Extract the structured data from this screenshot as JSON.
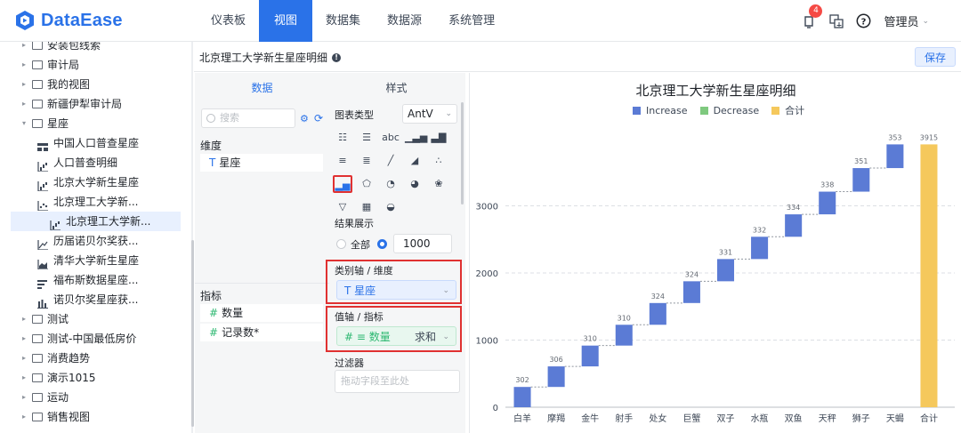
{
  "app": {
    "name": "DataEase"
  },
  "nav": [
    {
      "label": "仪表板",
      "active": false
    },
    {
      "label": "视图",
      "active": true
    },
    {
      "label": "数据集",
      "active": false
    },
    {
      "label": "数据源",
      "active": false
    },
    {
      "label": "系统管理",
      "active": false
    }
  ],
  "header": {
    "notification_count": "4",
    "user": "管理员"
  },
  "tree": [
    {
      "label": "安装包线索",
      "type": "folder",
      "level": 1,
      "expanded": false
    },
    {
      "label": "审计局",
      "type": "folder",
      "level": 1,
      "expanded": false
    },
    {
      "label": "我的视图",
      "type": "folder",
      "level": 1,
      "expanded": false
    },
    {
      "label": "新疆伊犁审计局",
      "type": "folder",
      "level": 1,
      "expanded": false
    },
    {
      "label": "星座",
      "type": "folder",
      "level": 1,
      "expanded": true
    },
    {
      "label": "中国人口普查星座",
      "type": "table",
      "level": 2
    },
    {
      "label": "人口普查明细",
      "type": "waterfall",
      "level": 2
    },
    {
      "label": "北京大学新生星座",
      "type": "waterfall",
      "level": 2
    },
    {
      "label": "北京理工大学新...",
      "type": "scatter",
      "level": 2
    },
    {
      "label": "北京理工大学新...",
      "type": "waterfall",
      "level": 2,
      "selected": true
    },
    {
      "label": "历届诺贝尔奖获...",
      "type": "line",
      "level": 2
    },
    {
      "label": "清华大学新生星座",
      "type": "area",
      "level": 2
    },
    {
      "label": "福布斯数据星座...",
      "type": "hbar",
      "level": 2
    },
    {
      "label": "诺贝尔奖星座获...",
      "type": "bar",
      "level": 2
    },
    {
      "label": "测试",
      "type": "folder",
      "level": 1,
      "expanded": false
    },
    {
      "label": "测试-中国最低房价",
      "type": "folder",
      "level": 1,
      "expanded": false
    },
    {
      "label": "消费趋势",
      "type": "folder",
      "level": 1,
      "expanded": false
    },
    {
      "label": "演示1015",
      "type": "folder",
      "level": 1,
      "expanded": false
    },
    {
      "label": "运动",
      "type": "folder",
      "level": 1,
      "expanded": false
    },
    {
      "label": "销售视图",
      "type": "folder",
      "level": 1,
      "expanded": false
    }
  ],
  "editor": {
    "title": "北京理工大学新生星座明细",
    "save_label": "保存"
  },
  "data_panel": {
    "tab": "数据",
    "search_placeholder": "搜索",
    "dimension_label": "维度",
    "dimensions": [
      {
        "label": "星座"
      }
    ],
    "measure_label": "指标",
    "measures": [
      {
        "label": "数量"
      },
      {
        "label": "记录数*"
      }
    ]
  },
  "style_panel": {
    "tab": "样式",
    "chart_type_label": "图表类型",
    "engine": "AntV",
    "result_label": "结果展示",
    "all_label": "全部",
    "limit_value": "1000",
    "category_axis_label": "类别轴 / 维度",
    "category_field": "星座",
    "value_axis_label": "值轴 / 指标",
    "value_field": "数量",
    "aggregation": "求和",
    "filter_label": "过滤器",
    "filter_placeholder": "拖动字段至此处"
  },
  "colors": {
    "increase": "#5b7bd5",
    "decrease": "#7fc97f",
    "total": "#f5c85c",
    "accent": "#2a72e8",
    "highlight": "#e03131"
  },
  "chart_data": {
    "type": "waterfall",
    "title": "北京理工大学新生星座明细",
    "legend": [
      "Increase",
      "Decrease",
      "合计"
    ],
    "legend_position": "top-center",
    "categories": [
      "白羊",
      "摩羯",
      "金牛",
      "射手",
      "处女",
      "巨蟹",
      "双子",
      "水瓶",
      "双鱼",
      "天秤",
      "狮子",
      "天蝎",
      "合计"
    ],
    "values": [
      302,
      306,
      310,
      310,
      324,
      324,
      331,
      332,
      334,
      338,
      351,
      353,
      3915
    ],
    "yticks": [
      0,
      1000,
      2000,
      3000
    ],
    "ylim": [
      0,
      4450
    ],
    "grid": true
  }
}
